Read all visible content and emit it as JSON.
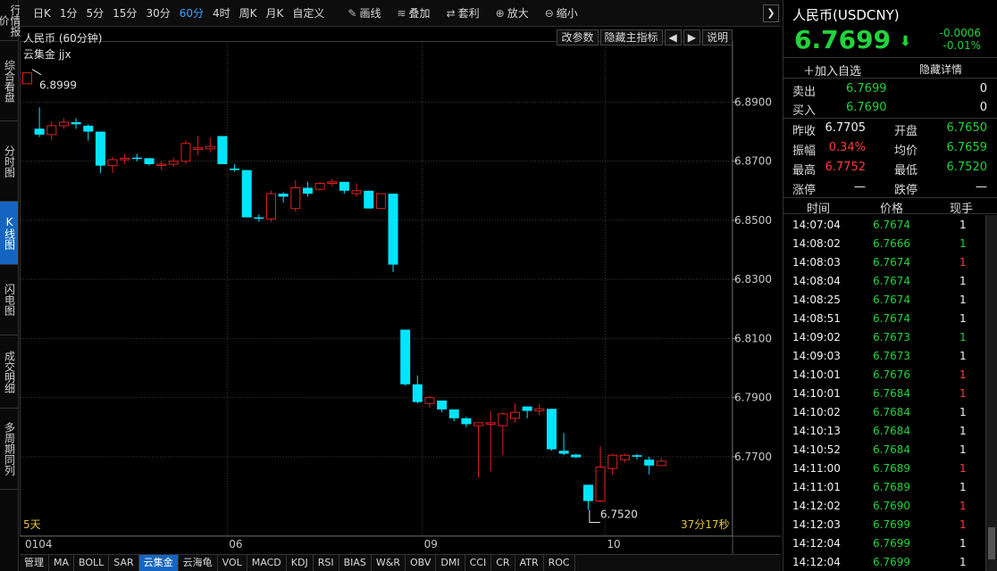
{
  "left_tabs": [
    "行情报价",
    "综合看盘",
    "分时图",
    "K线图",
    "闪电图",
    "成交明细",
    "多周期同列"
  ],
  "left_tab_active": 3,
  "toolbar": {
    "periods": [
      "日K",
      "1分",
      "5分",
      "15分",
      "30分",
      "60分",
      "4时",
      "周K",
      "月K",
      "自定义"
    ],
    "active_period": "60分",
    "tools": [
      {
        "icon": "pencil-icon",
        "glyph": "✎",
        "label": "画线"
      },
      {
        "icon": "layers-icon",
        "glyph": "≋",
        "label": "叠加"
      },
      {
        "icon": "arbitrage-icon",
        "glyph": "⇄",
        "label": "套利"
      },
      {
        "icon": "zoom-in-icon",
        "glyph": "⊕",
        "label": "放大"
      },
      {
        "icon": "zoom-out-icon",
        "glyph": "⊖",
        "label": "缩小"
      }
    ],
    "next_glyph": "❯"
  },
  "chart": {
    "title": "人民币 (60分钟)",
    "indicator_label": "云集金 jjx",
    "buttons": [
      "改参数",
      "隐藏主指标",
      "◀",
      "▶",
      "说明"
    ],
    "range_label": "5天",
    "countdown": "37分17秒",
    "high_label": "6.8999",
    "low_label": "6.7520"
  },
  "chart_data": {
    "type": "candlestick",
    "y_ticks": [
      "6.8900",
      "6.8700",
      "6.8500",
      "6.8300",
      "6.8100",
      "6.7900",
      "6.7700"
    ],
    "ylim": [
      6.744,
      6.901
    ],
    "x_labels": [
      {
        "label": "0104",
        "index": 0
      },
      {
        "label": "06",
        "index": 17
      },
      {
        "label": "09",
        "index": 33
      },
      {
        "label": "10",
        "index": 48
      }
    ],
    "up_color": "#e02020",
    "down_color": "#00e5ff",
    "candles": [
      {
        "o": 6.8962,
        "h": 6.8999,
        "l": 6.8962,
        "c": 6.8999
      },
      {
        "o": 6.881,
        "h": 6.8882,
        "l": 6.8782,
        "c": 6.879
      },
      {
        "o": 6.879,
        "h": 6.8835,
        "l": 6.877,
        "c": 6.882
      },
      {
        "o": 6.882,
        "h": 6.8845,
        "l": 6.881,
        "c": 6.8832
      },
      {
        "o": 6.8832,
        "h": 6.8845,
        "l": 6.881,
        "c": 6.8825
      },
      {
        "o": 6.882,
        "h": 6.8825,
        "l": 6.877,
        "c": 6.88
      },
      {
        "o": 6.88,
        "h": 6.88,
        "l": 6.866,
        "c": 6.8685
      },
      {
        "o": 6.8685,
        "h": 6.8715,
        "l": 6.866,
        "c": 6.8705
      },
      {
        "o": 6.8705,
        "h": 6.8725,
        "l": 6.869,
        "c": 6.871
      },
      {
        "o": 6.8712,
        "h": 6.8725,
        "l": 6.87,
        "c": 6.871
      },
      {
        "o": 6.871,
        "h": 6.871,
        "l": 6.8685,
        "c": 6.869
      },
      {
        "o": 6.8688,
        "h": 6.87,
        "l": 6.867,
        "c": 6.869
      },
      {
        "o": 6.869,
        "h": 6.871,
        "l": 6.868,
        "c": 6.87
      },
      {
        "o": 6.87,
        "h": 6.877,
        "l": 6.869,
        "c": 6.876
      },
      {
        "o": 6.874,
        "h": 6.8785,
        "l": 6.872,
        "c": 6.8745
      },
      {
        "o": 6.8742,
        "h": 6.878,
        "l": 6.873,
        "c": 6.875
      },
      {
        "o": 6.8785,
        "h": 6.8785,
        "l": 6.869,
        "c": 6.869
      },
      {
        "o": 6.8675,
        "h": 6.869,
        "l": 6.8665,
        "c": 6.867
      },
      {
        "o": 6.867,
        "h": 6.867,
        "l": 6.851,
        "c": 6.851
      },
      {
        "o": 6.851,
        "h": 6.852,
        "l": 6.8495,
        "c": 6.8505
      },
      {
        "o": 6.8505,
        "h": 6.86,
        "l": 6.8495,
        "c": 6.859
      },
      {
        "o": 6.859,
        "h": 6.8595,
        "l": 6.856,
        "c": 6.858
      },
      {
        "o": 6.854,
        "h": 6.8635,
        "l": 6.853,
        "c": 6.861
      },
      {
        "o": 6.861,
        "h": 6.863,
        "l": 6.858,
        "c": 6.859
      },
      {
        "o": 6.8605,
        "h": 6.863,
        "l": 6.86,
        "c": 6.8625
      },
      {
        "o": 6.8625,
        "h": 6.864,
        "l": 6.8615,
        "c": 6.863
      },
      {
        "o": 6.863,
        "h": 6.863,
        "l": 6.859,
        "c": 6.86
      },
      {
        "o": 6.859,
        "h": 6.8625,
        "l": 6.858,
        "c": 6.86
      },
      {
        "o": 6.86,
        "h": 6.86,
        "l": 6.854,
        "c": 6.854
      },
      {
        "o": 6.854,
        "h": 6.859,
        "l": 6.854,
        "c": 6.859
      },
      {
        "o": 6.859,
        "h": 6.859,
        "l": 6.8325,
        "c": 6.835
      },
      {
        "o": 6.813,
        "h": 6.813,
        "l": 6.794,
        "c": 6.7945
      },
      {
        "o": 6.7945,
        "h": 6.7975,
        "l": 6.788,
        "c": 6.7885
      },
      {
        "o": 6.788,
        "h": 6.7905,
        "l": 6.7865,
        "c": 6.79
      },
      {
        "o": 6.789,
        "h": 6.789,
        "l": 6.785,
        "c": 6.786
      },
      {
        "o": 6.786,
        "h": 6.786,
        "l": 6.782,
        "c": 6.783
      },
      {
        "o": 6.783,
        "h": 6.7835,
        "l": 6.78,
        "c": 6.781
      },
      {
        "o": 6.7805,
        "h": 6.7815,
        "l": 6.763,
        "c": 6.7815
      },
      {
        "o": 6.781,
        "h": 6.7855,
        "l": 6.765,
        "c": 6.7815
      },
      {
        "o": 6.7805,
        "h": 6.785,
        "l": 6.7705,
        "c": 6.7845
      },
      {
        "o": 6.783,
        "h": 6.788,
        "l": 6.7815,
        "c": 6.785
      },
      {
        "o": 6.787,
        "h": 6.787,
        "l": 6.783,
        "c": 6.7855
      },
      {
        "o": 6.7855,
        "h": 6.788,
        "l": 6.784,
        "c": 6.7862
      },
      {
        "o": 6.7862,
        "h": 6.7862,
        "l": 6.772,
        "c": 6.7725
      },
      {
        "o": 6.772,
        "h": 6.778,
        "l": 6.7705,
        "c": 6.771
      },
      {
        "o": 6.7707,
        "h": 6.771,
        "l": 6.7695,
        "c": 6.7698
      },
      {
        "o": 6.7605,
        "h": 6.76,
        "l": 6.752,
        "c": 6.755
      },
      {
        "o": 6.755,
        "h": 6.7735,
        "l": 6.7545,
        "c": 6.7665
      },
      {
        "o": 6.766,
        "h": 6.771,
        "l": 6.764,
        "c": 6.7705
      },
      {
        "o": 6.769,
        "h": 6.771,
        "l": 6.768,
        "c": 6.7705
      },
      {
        "o": 6.7705,
        "h": 6.771,
        "l": 6.769,
        "c": 6.77
      },
      {
        "o": 6.769,
        "h": 6.77,
        "l": 6.764,
        "c": 6.767
      },
      {
        "o": 6.767,
        "h": 6.7695,
        "l": 6.767,
        "c": 6.7685
      }
    ]
  },
  "indicator_tabs": [
    "管理",
    "MA",
    "BOLL",
    "SAR",
    "云集金",
    "云海龟",
    "VOL",
    "MACD",
    "KDJ",
    "RSI",
    "BIAS",
    "W&R",
    "OBV",
    "DMI",
    "CCI",
    "CR",
    "ATR",
    "ROC"
  ],
  "indicator_active": "云集金",
  "quote": {
    "name": "人民币(USDCNY)",
    "price": "6.7699",
    "arrow": "⬇",
    "change": "-0.0006",
    "change_pct": "-0.01%",
    "add_watch": "＋加入自选",
    "hide_detail": "隐藏详情",
    "sell": {
      "label": "卖出",
      "price": "6.7699",
      "vol": "0"
    },
    "buy": {
      "label": "买入",
      "price": "6.7690",
      "vol": "0"
    },
    "stats": [
      {
        "l1": "昨收",
        "v1": "6.7705",
        "c1": "white",
        "l2": "开盘",
        "v2": "6.7650",
        "c2": "green"
      },
      {
        "l1": "振幅",
        "v1": "0.34%",
        "c1": "red",
        "l2": "均价",
        "v2": "6.7659",
        "c2": "green"
      },
      {
        "l1": "最高",
        "v1": "6.7752",
        "c1": "red",
        "l2": "最低",
        "v2": "6.7520",
        "c2": "green"
      },
      {
        "l1": "涨停",
        "v1": "—",
        "c1": "white",
        "l2": "跌停",
        "v2": "—",
        "c2": "white"
      }
    ]
  },
  "ticks": {
    "headers": [
      "时间",
      "价格",
      "现手"
    ],
    "rows": [
      {
        "time": "14:07:04",
        "price": "6.7674",
        "vol": "1",
        "vc": "white"
      },
      {
        "time": "14:08:02",
        "price": "6.7666",
        "vol": "1",
        "vc": "green"
      },
      {
        "time": "14:08:03",
        "price": "6.7674",
        "vol": "1",
        "vc": "red"
      },
      {
        "time": "14:08:04",
        "price": "6.7674",
        "vol": "1",
        "vc": "white"
      },
      {
        "time": "14:08:25",
        "price": "6.7674",
        "vol": "1",
        "vc": "white"
      },
      {
        "time": "14:08:51",
        "price": "6.7674",
        "vol": "1",
        "vc": "white"
      },
      {
        "time": "14:09:02",
        "price": "6.7673",
        "vol": "1",
        "vc": "green"
      },
      {
        "time": "14:09:03",
        "price": "6.7673",
        "vol": "1",
        "vc": "white"
      },
      {
        "time": "14:10:01",
        "price": "6.7676",
        "vol": "1",
        "vc": "red"
      },
      {
        "time": "14:10:01",
        "price": "6.7684",
        "vol": "1",
        "vc": "red"
      },
      {
        "time": "14:10:02",
        "price": "6.7684",
        "vol": "1",
        "vc": "white"
      },
      {
        "time": "14:10:13",
        "price": "6.7684",
        "vol": "1",
        "vc": "white"
      },
      {
        "time": "14:10:52",
        "price": "6.7684",
        "vol": "1",
        "vc": "white"
      },
      {
        "time": "14:11:00",
        "price": "6.7689",
        "vol": "1",
        "vc": "red"
      },
      {
        "time": "14:11:01",
        "price": "6.7689",
        "vol": "1",
        "vc": "white"
      },
      {
        "time": "14:12:02",
        "price": "6.7690",
        "vol": "1",
        "vc": "red"
      },
      {
        "time": "14:12:03",
        "price": "6.7699",
        "vol": "1",
        "vc": "red"
      },
      {
        "time": "14:12:04",
        "price": "6.7699",
        "vol": "1",
        "vc": "white"
      },
      {
        "time": "14:12:04",
        "price": "6.7699",
        "vol": "1",
        "vc": "white"
      }
    ]
  }
}
